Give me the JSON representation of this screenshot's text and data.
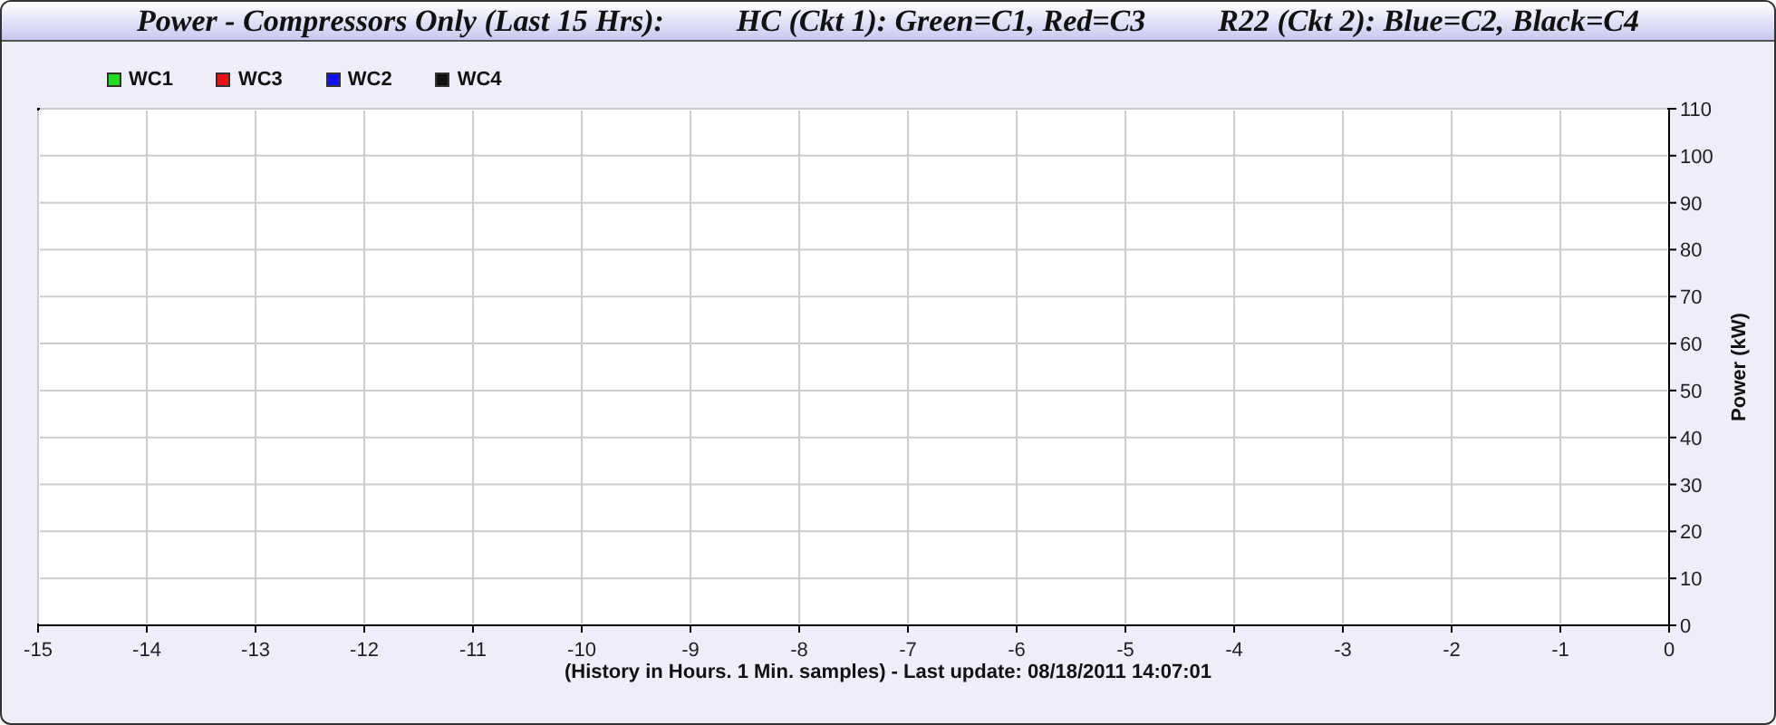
{
  "title": [
    "Power - Compressors Only (Last 15 Hrs):",
    "HC (Ckt 1): Green=C1, Red=C3",
    "R22 (Ckt 2): Blue=C2, Black=C4"
  ],
  "chart_data": {
    "type": "line",
    "xlabel": "(History in Hours. 1 Min. samples) - Last update: 08/18/2011 14:07:01",
    "ylabel": "Power (kW)",
    "series": [
      {
        "name": "WC1",
        "color": "#22dd22",
        "values": [
          null,
          null,
          null,
          null,
          null,
          null,
          null,
          null,
          null,
          null,
          null,
          null,
          null,
          null,
          null,
          null
        ]
      },
      {
        "name": "WC3",
        "color": "#ee1111",
        "values": [
          null,
          null,
          null,
          null,
          null,
          null,
          null,
          null,
          null,
          null,
          null,
          null,
          null,
          null,
          null,
          null
        ]
      },
      {
        "name": "WC2",
        "color": "#1111ee",
        "values": [
          null,
          null,
          null,
          null,
          null,
          null,
          null,
          null,
          null,
          null,
          null,
          null,
          null,
          null,
          null,
          null
        ]
      },
      {
        "name": "WC4",
        "color": "#111111",
        "values": [
          null,
          null,
          null,
          null,
          null,
          null,
          null,
          null,
          null,
          null,
          null,
          null,
          null,
          null,
          null,
          null
        ]
      }
    ],
    "ylim": [
      0,
      110
    ],
    "grid": true,
    "categories": [
      "-15",
      "-14",
      "-13",
      "-12",
      "-11",
      "-10",
      "-9",
      "-8",
      "-7",
      "-6",
      "-5",
      "-4",
      "-3",
      "-2",
      "-1",
      "0"
    ],
    "yticks": [
      0,
      10,
      20,
      30,
      40,
      50,
      60,
      70,
      80,
      90,
      100,
      110
    ]
  }
}
